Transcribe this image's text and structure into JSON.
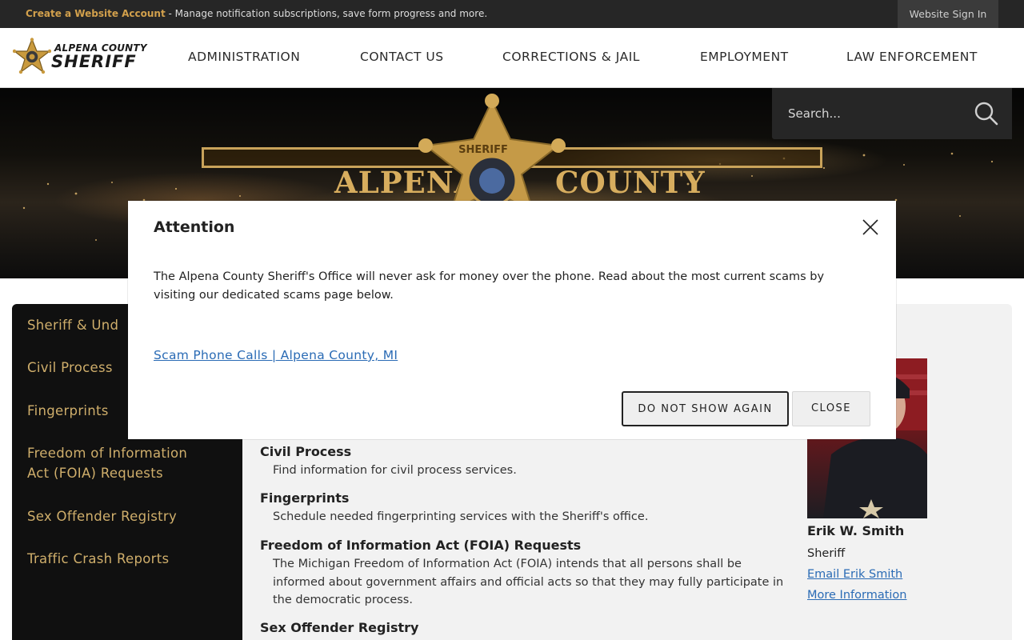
{
  "topbar": {
    "create_account_link": "Create a Website Account",
    "create_account_desc": " - Manage notification subscriptions, save form progress and more.",
    "sign_in": "Website Sign In"
  },
  "logo": {
    "line1": "ALPENA COUNTY",
    "line2": "SHERIFF"
  },
  "nav": [
    "ADMINISTRATION",
    "CONTACT US",
    "CORRECTIONS & JAIL",
    "EMPLOYMENT",
    "LAW ENFORCEMENT"
  ],
  "hero": {
    "left_text": "ALPENA",
    "right_text": "COUNTY",
    "badge_text": "SHERIFF"
  },
  "search": {
    "placeholder": "Search..."
  },
  "sidenav": {
    "items": [
      "Sheriff & Und",
      "Civil Process",
      "Fingerprints",
      "Freedom of Information Act (FOIA) Requests",
      "Sex Offender Registry",
      "Traffic Crash Reports"
    ]
  },
  "content": {
    "entries": [
      {
        "title": "Civil Process",
        "desc": "Find information for civil process services."
      },
      {
        "title": "Fingerprints",
        "desc": "Schedule needed fingerprinting services with the Sheriff's office."
      },
      {
        "title": "Freedom of Information Act (FOIA) Requests",
        "desc": "The Michigan Freedom of Information Act (FOIA) intends that all persons shall be informed about government affairs and official acts so that they may fully participate in the democratic process."
      },
      {
        "title": "Sex Offender Registry",
        "desc": ""
      }
    ]
  },
  "profile": {
    "name": "Erik W. Smith",
    "title": "Sheriff",
    "email_link": "Email Erik Smith",
    "more_link": "More Information"
  },
  "dialog": {
    "title": "Attention",
    "body": "The Alpena County Sheriff's Office will never ask for money over the phone. Read about the most current scams by visiting our dedicated scams page below.",
    "link": "Scam Phone Calls | Alpena County, MI",
    "dont_show_label": "DO NOT SHOW AGAIN",
    "close_label": "CLOSE"
  },
  "colors": {
    "topbar_bg": "#262626",
    "accent_gold": "#d2a04c",
    "sidenav_bg": "#101010",
    "link_blue": "#2a6bb5"
  }
}
